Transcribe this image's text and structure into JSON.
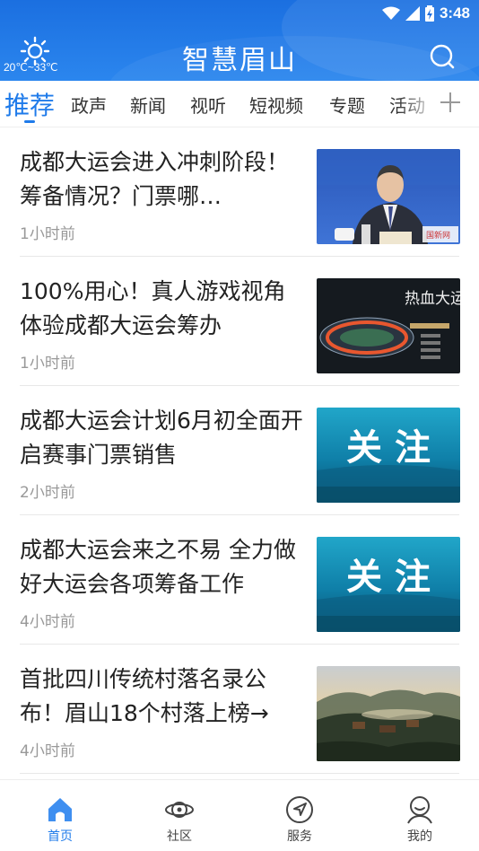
{
  "status": {
    "time": "3:48"
  },
  "header": {
    "title": "智慧眉山",
    "weather_temp": "20℃~33℃",
    "search_icon": "search-icon"
  },
  "tabs": [
    {
      "label": "推荐",
      "active": true
    },
    {
      "label": "政声"
    },
    {
      "label": "新闻"
    },
    {
      "label": "视听"
    },
    {
      "label": "短视频"
    },
    {
      "label": "专题"
    },
    {
      "label": "活动"
    }
  ],
  "news": [
    {
      "title": "成都大运会进入冲刺阶段！筹备情况？门票哪…",
      "time": "1小时前",
      "thumb": "press-conference"
    },
    {
      "title": "100%用心！真人游戏视角体验成都大运会筹办",
      "time": "1小时前",
      "thumb": "stadium"
    },
    {
      "title": "成都大运会计划6月初全面开启赛事门票销售",
      "time": "2小时前",
      "thumb": "focus",
      "thumb_text": "关 注"
    },
    {
      "title": "成都大运会来之不易 全力做好大运会各项筹备工作",
      "time": "4小时前",
      "thumb": "focus",
      "thumb_text": "关 注"
    },
    {
      "title": "首批四川传统村落名录公布！眉山18个村落上榜→",
      "time": "4小时前",
      "thumb": "village"
    }
  ],
  "thumb_texts": {
    "stadium_title": "热血大运",
    "press_tag": "国新网"
  },
  "nav": [
    {
      "label": "首页",
      "icon": "home-icon",
      "active": true
    },
    {
      "label": "社区",
      "icon": "planet-icon"
    },
    {
      "label": "服务",
      "icon": "compass-icon"
    },
    {
      "label": "我的",
      "icon": "user-icon"
    }
  ],
  "colors": {
    "brand": "#1f7bea",
    "header": "#2b86ee",
    "text": "#222222",
    "muted": "#999999"
  }
}
